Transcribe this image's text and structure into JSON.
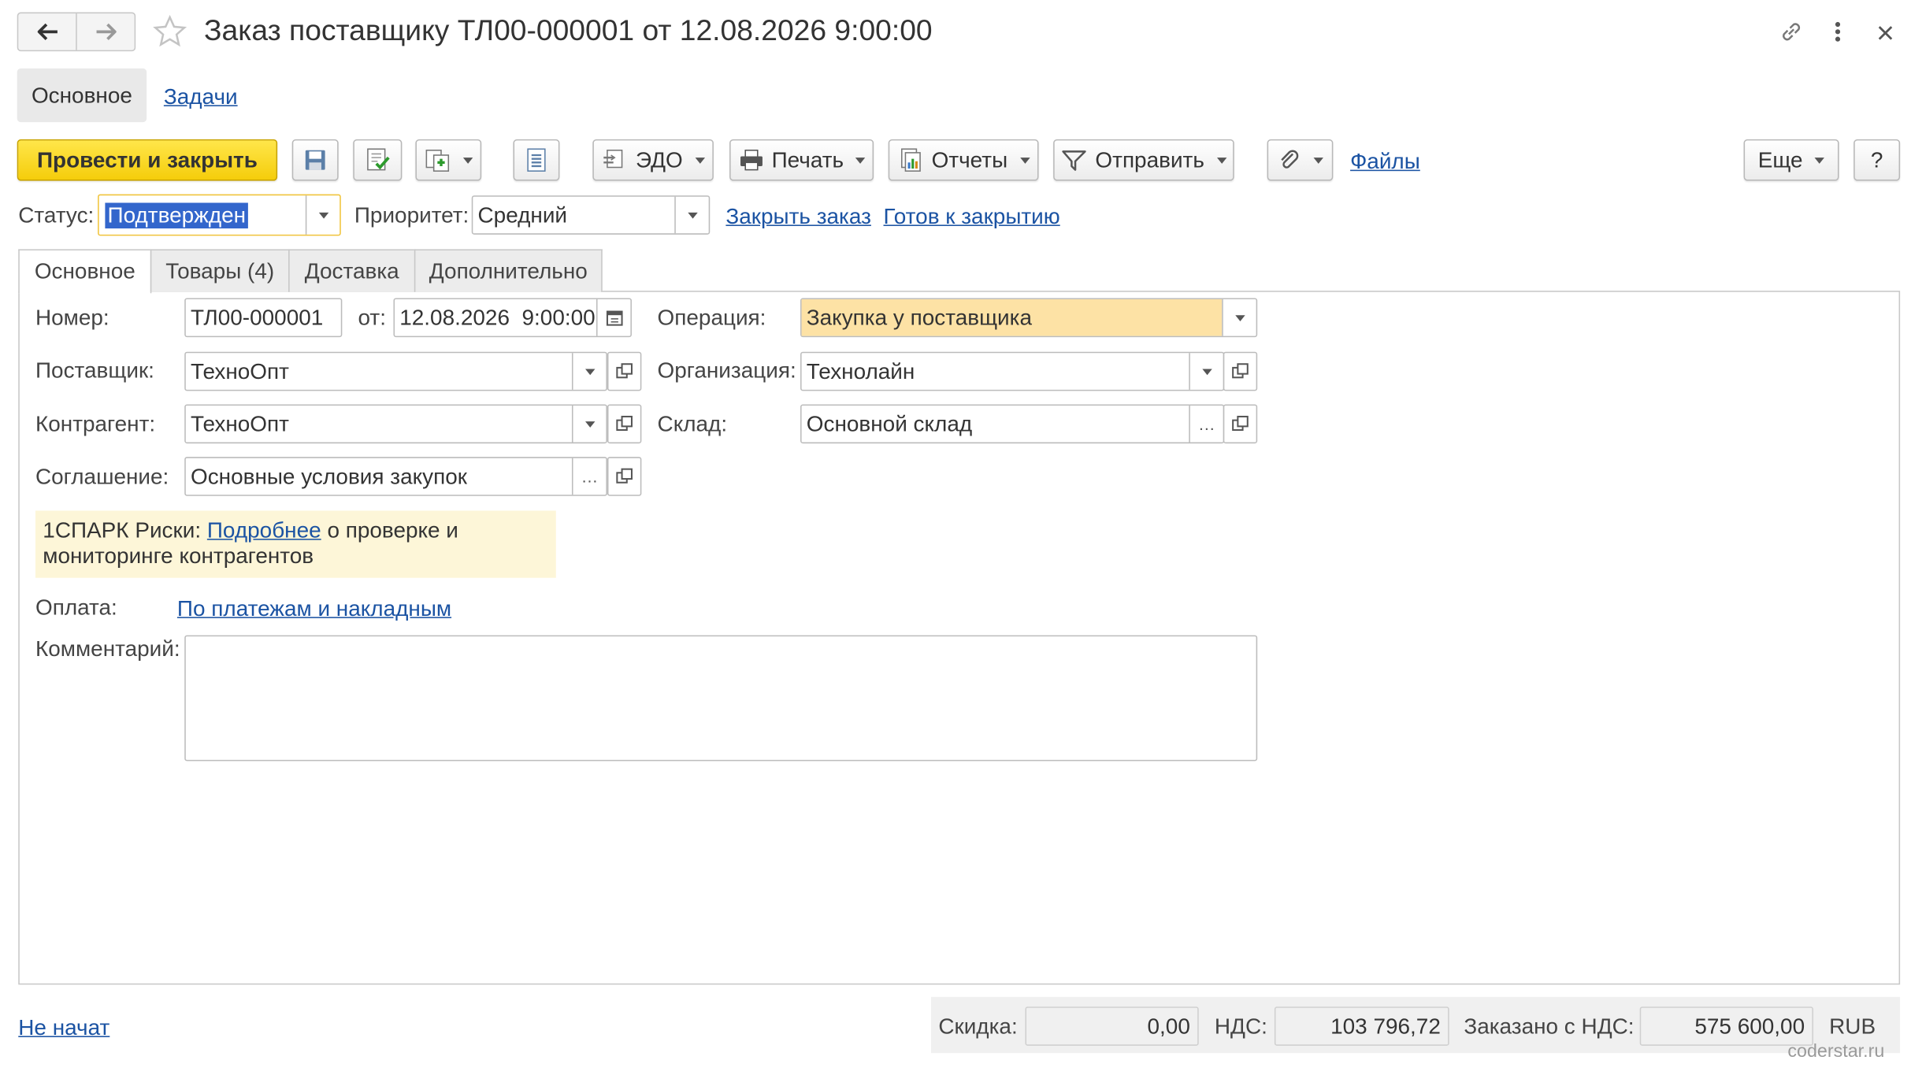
{
  "window": {
    "title": "Заказ поставщику ТЛ00-000001 от 12.08.2026 9:00:00",
    "icons": [
      "back-arrow-icon",
      "forward-arrow-icon",
      "star-icon",
      "link-icon",
      "more-vert-icon",
      "close-icon"
    ]
  },
  "top_tabs": {
    "main": "Основное",
    "tasks": "Задачи"
  },
  "toolbar": {
    "post_close": "Провести и закрыть",
    "edo": "ЭДО",
    "print": "Печать",
    "reports": "Отчеты",
    "send": "Отправить",
    "files": "Файлы",
    "more": "Еще",
    "help": "?"
  },
  "status_row": {
    "status_label": "Статус:",
    "status_value": "Подтвержден",
    "priority_label": "Приоритет:",
    "priority_value": "Средний",
    "close_order": "Закрыть заказ",
    "ready_to_close": "Готов к закрытию"
  },
  "form_tabs": [
    "Основное",
    "Товары (4)",
    "Доставка",
    "Дополнительно"
  ],
  "main_form": {
    "number_label": "Номер:",
    "number_value": "ТЛ00-000001",
    "date_label": "от:",
    "date_value": "12.08.2026  9:00:00",
    "operation_label": "Операция:",
    "operation_value": "Закупка у поставщика",
    "supplier_label": "Поставщик:",
    "supplier_value": "ТехноОпт",
    "org_label": "Организация:",
    "org_value": "Технолайн",
    "counterparty_label": "Контрагент:",
    "counterparty_value": "ТехноОпт",
    "warehouse_label": "Склад:",
    "warehouse_value": "Основной склад",
    "agreement_label": "Соглашение:",
    "agreement_value": "Основные условия закупок",
    "spark_prefix": "1СПАРК Риски:",
    "spark_link": "Подробнее",
    "spark_suffix": "о проверке и",
    "spark_line2": "мониторинге контрагентов",
    "payment_label": "Оплата:",
    "payment_link": "По платежам и накладным",
    "comment_label": "Комментарий:",
    "comment_value": ""
  },
  "footer": {
    "state_link": "Не начат",
    "discount_label": "Скидка:",
    "discount_value": "0,00",
    "vat_label": "НДС:",
    "vat_value": "103 796,72",
    "ordered_label": "Заказано с НДС:",
    "ordered_value": "575 600,00",
    "currency": "RUB"
  },
  "watermark": "coderstar.ru",
  "colors": {
    "primary_button": "#f5cd0b",
    "link": "#1b53a3",
    "operation_highlight": "#fde2a5",
    "spark_panel": "#fdf6d8",
    "status_selection": "#3366cc"
  }
}
